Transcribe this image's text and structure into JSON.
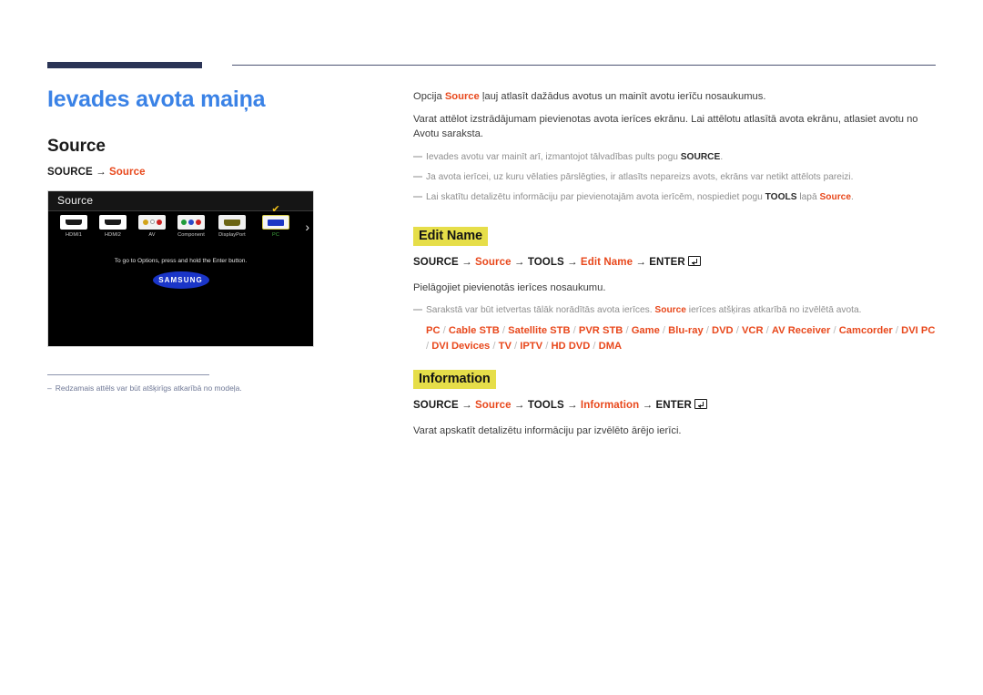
{
  "page": {
    "title": "Ievades avota maiņa"
  },
  "left": {
    "section_title": "Source",
    "path": {
      "key": "SOURCE",
      "arrow": "→",
      "target": "Source"
    },
    "tv": {
      "header_label": "Source",
      "sources": [
        {
          "label": "HDMI1",
          "icon": "hdmi-port-icon",
          "selected": false
        },
        {
          "label": "HDMI2",
          "icon": "hdmi-port-icon",
          "selected": false
        },
        {
          "label": "AV",
          "icon": "av-composite-icon",
          "selected": false
        },
        {
          "label": "Component",
          "icon": "component-video-icon",
          "selected": false
        },
        {
          "label": "DisplayPort",
          "icon": "displayport-icon",
          "selected": false
        },
        {
          "label": "PC",
          "icon": "vga-pc-icon",
          "selected": true
        }
      ],
      "next_arrow_icon": "chevron-right-icon",
      "check_icon": "checkmark-icon",
      "hint": "To go to Options, press and hold the Enter button.",
      "brand": "SAMSUNG"
    },
    "footnote": {
      "dash": "–",
      "text": "Redzamais attēls var būt atšķirīgs atkarībā no modeļa."
    }
  },
  "right": {
    "intro": {
      "p1_before": "Opcija ",
      "p1_highlight": "Source",
      "p1_after": " ļauj atlasīt dažādus avotus un mainīt avotu ierīču nosaukumus.",
      "p2": "Varat attēlot izstrādājumam pievienotas avota ierīces ekrānu. Lai attēlotu atlasītā avota ekrānu, atlasiet avotu no Avotu saraksta.",
      "notes": [
        {
          "text_before": "Ievades avotu var mainīt arī, izmantojot tālvadības pults pogu ",
          "bold": "SOURCE",
          "text_after": "."
        },
        {
          "text_before": "Ja avota ierīcei, uz kuru vēlaties pārslēgties, ir atlasīts nepareizs avots, ekrāns var netikt attēlots pareizi.",
          "bold": "",
          "text_after": ""
        },
        {
          "text_before": "Lai skatītu detalizētu informāciju par pievienotajām avota ierīcēm, nospiediet pogu ",
          "bold": "TOOLS",
          "text_mid": " lapā ",
          "orange": "Source",
          "text_after": "."
        }
      ]
    },
    "edit_name": {
      "heading": "Edit Name",
      "path": {
        "k1": "SOURCE",
        "a1": "→",
        "t1": "Source",
        "a2": "→",
        "k2": "TOOLS",
        "a3": "→",
        "t2": "Edit Name",
        "a4": "→",
        "k3": "ENTER"
      },
      "enter_icon": "enter-key-icon",
      "body": "Pielāgojiet pievienotās ierīces nosaukumu.",
      "note_before": "Sarakstā var būt ietvertas tālāk norādītās avota ierīces. ",
      "note_orange": "Source",
      "note_after": " ierīces atšķiras atkarībā no izvēlētā avota.",
      "devices": [
        "PC",
        "Cable STB",
        "Satellite STB",
        "PVR STB",
        "Game",
        "Blu-ray",
        "DVD",
        "VCR",
        "AV Receiver",
        "Camcorder",
        "DVI PC",
        "DVI Devices",
        "TV",
        "IPTV",
        "HD DVD",
        "DMA"
      ],
      "device_separator": "/"
    },
    "information": {
      "heading": "Information",
      "path": {
        "k1": "SOURCE",
        "a1": "→",
        "t1": "Source",
        "a2": "→",
        "k2": "TOOLS",
        "a3": "→",
        "t2": "Information",
        "a4": "→",
        "k3": "ENTER"
      },
      "enter_icon": "enter-key-icon",
      "body": "Varat apskatīt detalizētu informāciju par izvēlēto ārējo ierīci."
    }
  },
  "colors": {
    "title_blue": "#3a82e6",
    "accent_orange": "#e8481c",
    "highlight_yellow": "#e6de49",
    "rule_navy": "#2b3556",
    "footnote_blue_gray": "#6f7896",
    "selected_green": "#3fa83f"
  }
}
